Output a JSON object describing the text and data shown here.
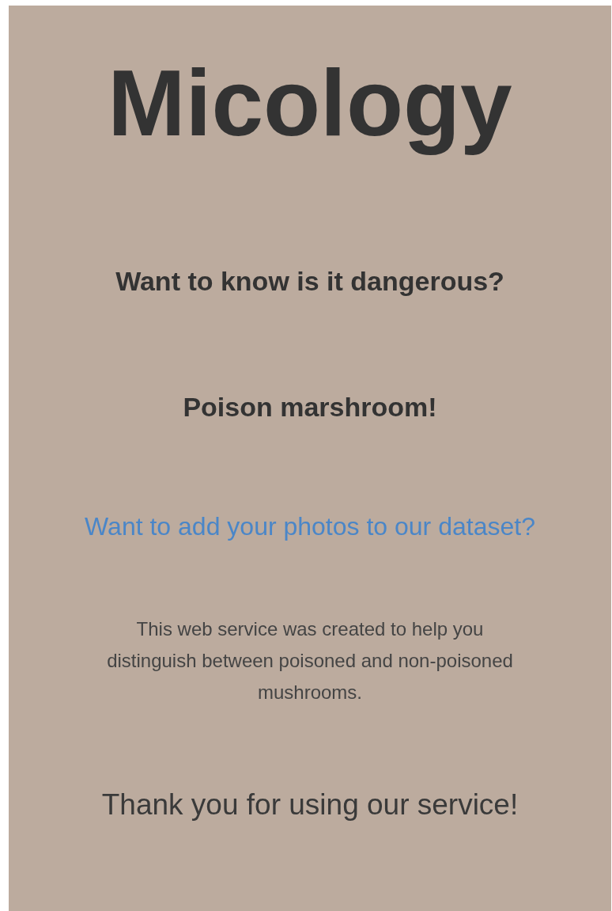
{
  "title": "Micology",
  "headings": [
    "Want to know is it dangerous?",
    "Poison marshroom!"
  ],
  "link": "Want to add your photos to our dataset?",
  "description": "This web service was created to help you distinguish between poisoned and non-poisoned mushrooms.",
  "thanks": "Thank you for using our service!"
}
